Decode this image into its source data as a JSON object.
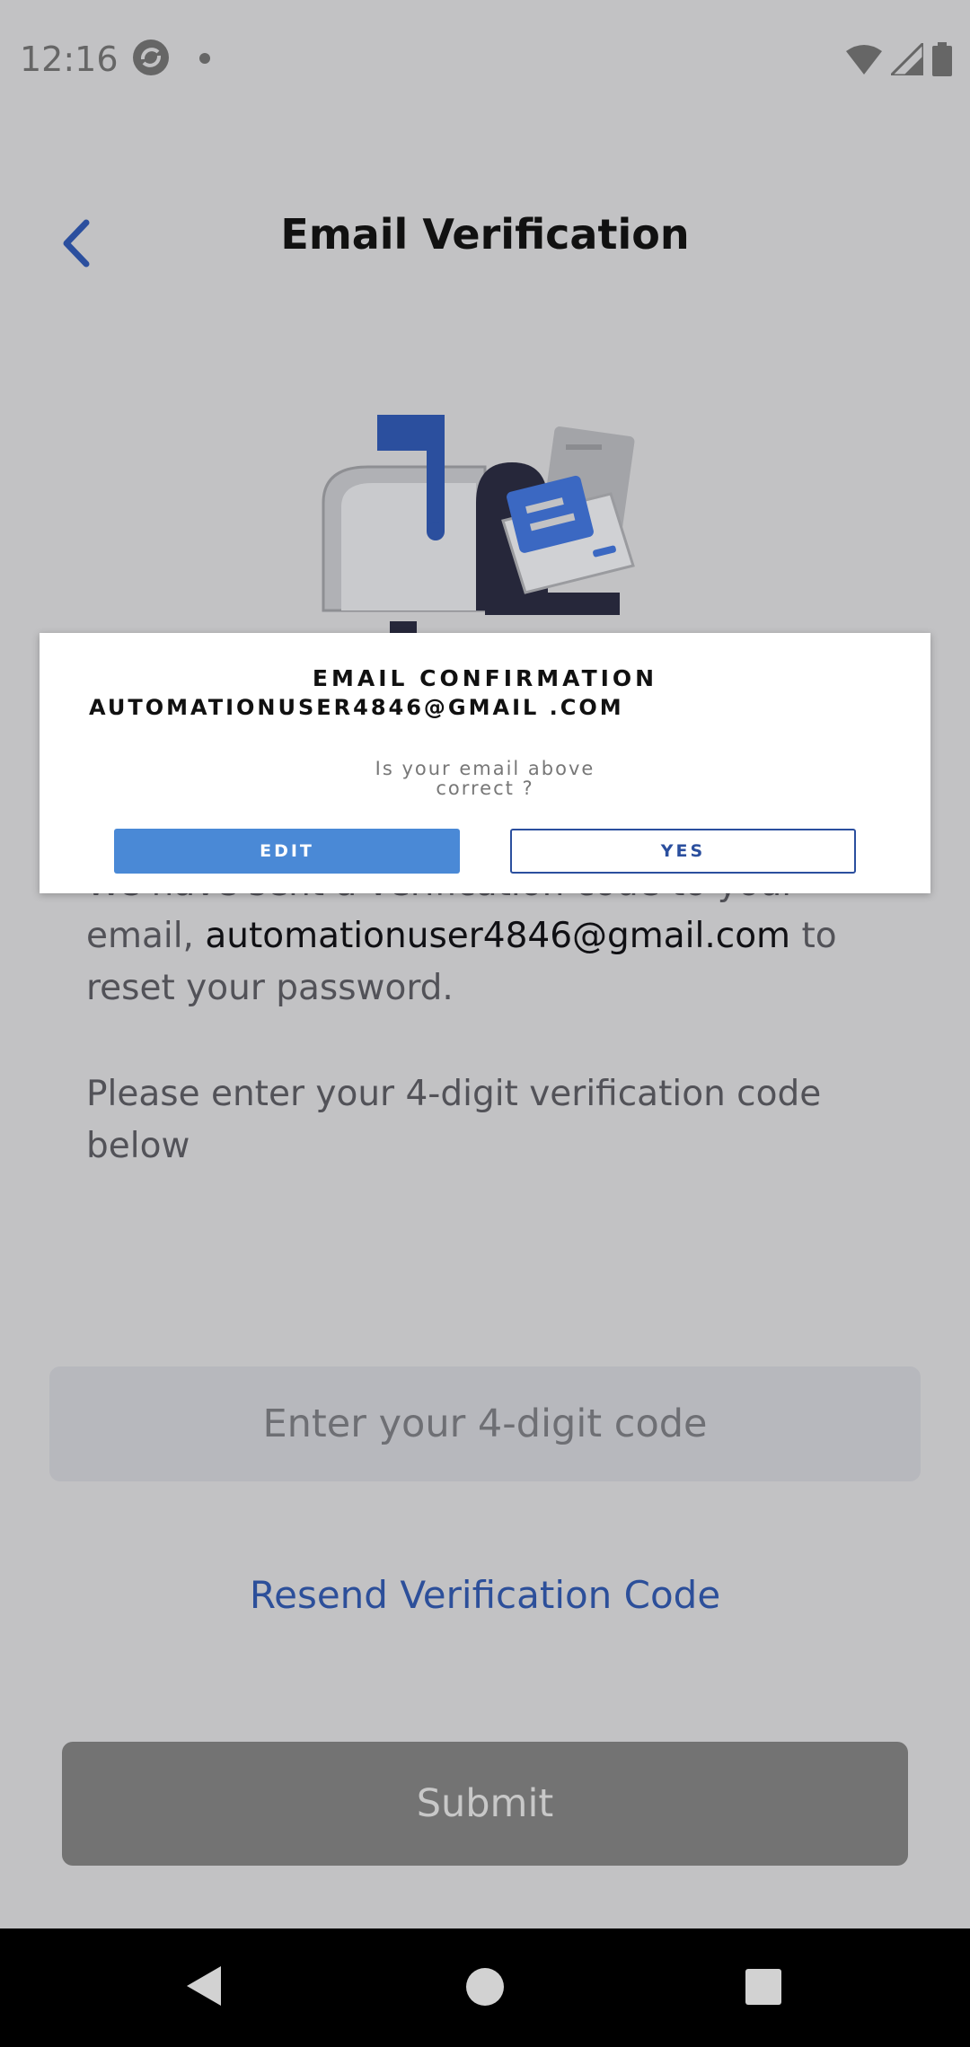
{
  "status_bar": {
    "time": "12:16",
    "icons": [
      "sync-icon",
      "notification-dot-icon",
      "wifi-icon",
      "signal-icon",
      "battery-icon"
    ]
  },
  "header": {
    "title": "Email Verification",
    "back_icon": "chevron-left-icon"
  },
  "body": {
    "para1_prefix": "We have sent a verification code to your email, ",
    "email": "automationuser4846@gmail.com",
    "para1_suffix": " to reset your password.",
    "para2": "Please enter your 4-digit verification code below"
  },
  "code_input": {
    "placeholder": "Enter your 4-digit code",
    "value": ""
  },
  "resend_label": "Resend Verification Code",
  "submit_label": "Submit",
  "dialog": {
    "title": "EMAIL CONFIRMATION",
    "email": "AUTOMATIONUSER4846@GMAIL .COM",
    "question": "Is your email above correct ?",
    "edit_label": "EDIT",
    "yes_label": "YES"
  },
  "nav_bar": {
    "icons": [
      "nav-back-icon",
      "nav-home-icon",
      "nav-recents-icon"
    ]
  },
  "colors": {
    "accent_blue": "#4a89d6",
    "dark_blue": "#2b4f9e",
    "overlay_gray": "#c2c2c4"
  }
}
